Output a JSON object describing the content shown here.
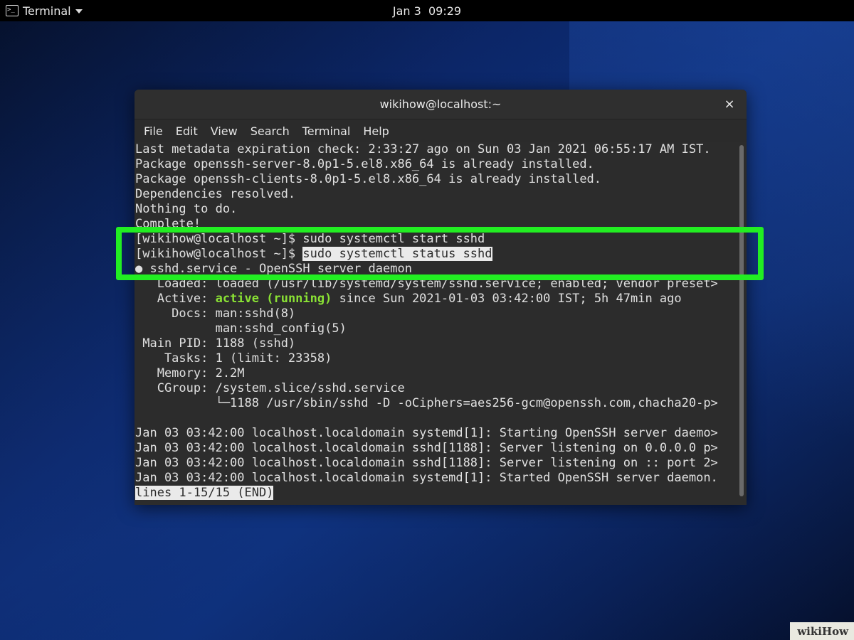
{
  "topbar": {
    "app_name": "Terminal",
    "date": "Jan 3",
    "time": "09:29"
  },
  "window": {
    "title": "wikihow@localhost:~",
    "close_glyph": "×",
    "menu": [
      "File",
      "Edit",
      "View",
      "Search",
      "Terminal",
      "Help"
    ]
  },
  "terminal": {
    "lines": [
      "Last metadata expiration check: 2:33:27 ago on Sun 03 Jan 2021 06:55:17 AM IST.",
      "Package openssh-server-8.0p1-5.el8.x86_64 is already installed.",
      "Package openssh-clients-8.0p1-5.el8.x86_64 is already installed.",
      "Dependencies resolved.",
      "Nothing to do.",
      "Complete!",
      "[wikihow@localhost ~]$ sudo systemctl start sshd"
    ],
    "prompt": "[wikihow@localhost ~]$ ",
    "status_command": "sudo systemctl status sshd",
    "service_line": "● sshd.service - OpenSSH server daemon",
    "loaded_line": "   Loaded: loaded (/usr/lib/systemd/system/sshd.service; enabled; vendor preset>",
    "active_label": "   Active: ",
    "active_state": "active (running)",
    "active_rest": " since Sun 2021-01-03 03:42:00 IST; 5h 47min ago",
    "details": [
      "     Docs: man:sshd(8)",
      "           man:sshd_config(5)",
      " Main PID: 1188 (sshd)",
      "    Tasks: 1 (limit: 23358)",
      "   Memory: 2.2M",
      "   CGroup: /system.slice/sshd.service",
      "           └─1188 /usr/sbin/sshd -D -oCiphers=aes256-gcm@openssh.com,chacha20-p>",
      "",
      "Jan 03 03:42:00 localhost.localdomain systemd[1]: Starting OpenSSH server daemo>",
      "Jan 03 03:42:00 localhost.localdomain sshd[1188]: Server listening on 0.0.0.0 p>",
      "Jan 03 03:42:00 localhost.localdomain sshd[1188]: Server listening on :: port 2>",
      "Jan 03 03:42:00 localhost.localdomain systemd[1]: Started OpenSSH server daemon."
    ],
    "pager_status": "lines 1-15/15 (END)"
  },
  "watermark": "wikiHow",
  "colors": {
    "annotation": "#22ee22",
    "active_green": "#8ae234",
    "terminal_bg": "#2c2c2c"
  }
}
